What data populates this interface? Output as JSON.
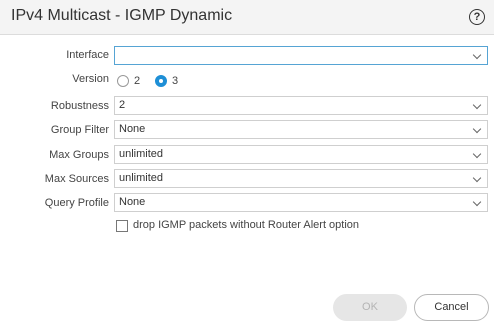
{
  "dialog": {
    "title": "IPv4 Multicast - IGMP Dynamic",
    "help_label": "?"
  },
  "form": {
    "interface": {
      "label": "Interface",
      "value": ""
    },
    "version": {
      "label": "Version",
      "options": [
        {
          "label": "2",
          "selected": false
        },
        {
          "label": "3",
          "selected": true
        }
      ]
    },
    "robustness": {
      "label": "Robustness",
      "value": "2"
    },
    "group_filter": {
      "label": "Group Filter",
      "value": "None"
    },
    "max_groups": {
      "label": "Max Groups",
      "value": "unlimited"
    },
    "max_sources": {
      "label": "Max Sources",
      "value": "unlimited"
    },
    "query_profile": {
      "label": "Query Profile",
      "value": "None"
    },
    "drop_packets": {
      "label": "drop IGMP packets without Router Alert option",
      "checked": false
    }
  },
  "buttons": {
    "ok_label": "OK",
    "cancel_label": "Cancel"
  },
  "colors": {
    "accent": "#1e8fd6",
    "focus_border": "#56a4d4",
    "header_bg": "#f4f4f4",
    "disabled_button_bg": "#e6e6e6"
  }
}
